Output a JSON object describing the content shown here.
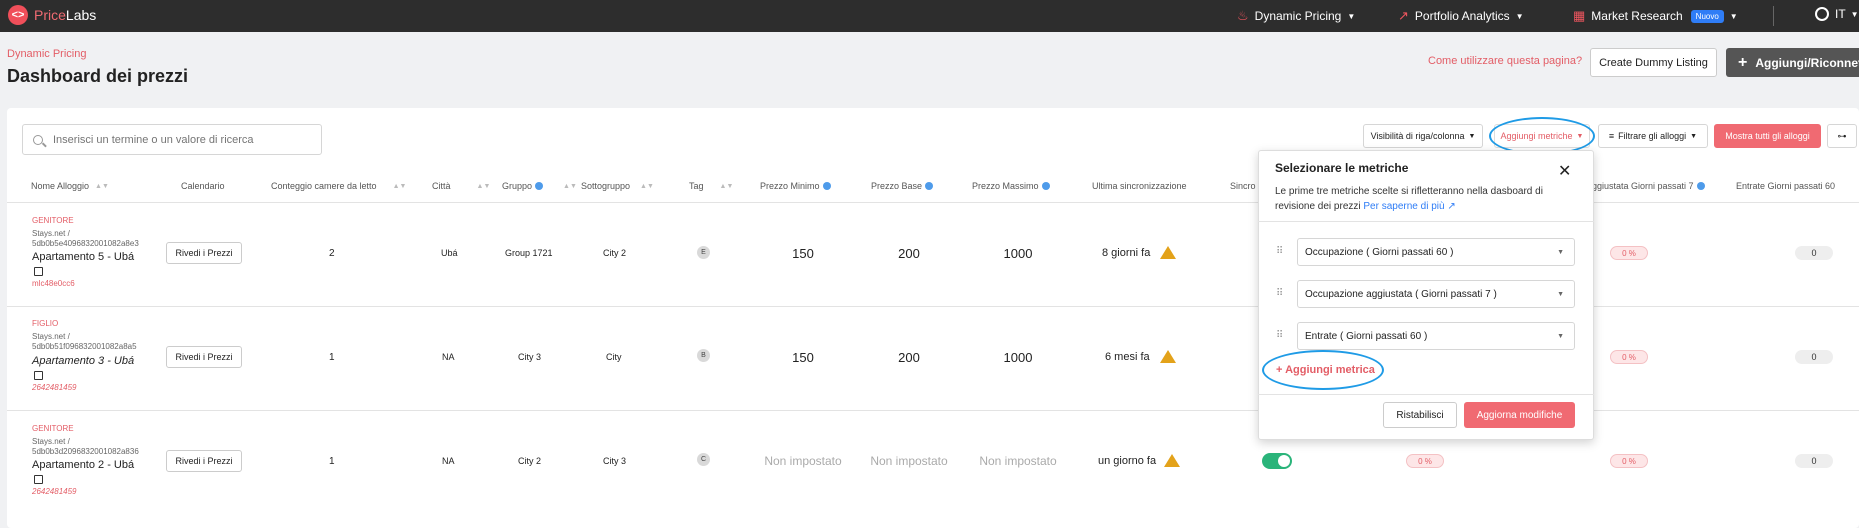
{
  "topbar": {
    "brand_a": "Price",
    "brand_b": "Labs",
    "nav": [
      {
        "label": "Dynamic Pricing"
      },
      {
        "label": "Portfolio Analytics"
      },
      {
        "label": "Market Research",
        "badge": "Nuovo"
      }
    ],
    "lang": "IT"
  },
  "header": {
    "breadcrumb": "Dynamic Pricing",
    "title": "Dashboard dei prezzi",
    "howto": "Come utilizzare questa pagina?",
    "dummy": "Create Dummy Listing",
    "add": "Aggiungi/Riconnetti"
  },
  "toolbar": {
    "search_placeholder": "Inserisci un termine o un valore di ricerca",
    "visibility": "Visibilità di riga/colonna",
    "metrics": "Aggiungi metriche",
    "filter": "Filtrare gli alloggi",
    "show_all": "Mostra tutti gli alloggi"
  },
  "columns": [
    "Nome Alloggio",
    "Calendario",
    "Conteggio camere da letto",
    "Città",
    "Gruppo",
    "Sottogruppo",
    "Tag",
    "Prezzo Minimo",
    "Prezzo Base",
    "Prezzo Massimo",
    "Ultima sincronizzazione",
    "Sincro",
    "ggiustata Giorni passati 7",
    "Entrate Giorni passati 60"
  ],
  "rows": [
    {
      "role": "GENITORE",
      "src1": "Stays.net /",
      "src2": "5db0b5e4096832001082a8e3",
      "name": "Apartamento 5 - Ubá",
      "id": "mlc48e0cc6",
      "review": "Rivedi i Prezzi",
      "bedrooms": "2",
      "city": "Ubá",
      "group": "Group 1721",
      "subgroup": "City 2",
      "tag": "E",
      "min": "150",
      "base": "200",
      "max": "1000",
      "sync": "8 giorni fa",
      "occ7": "0 %",
      "rev60": "0"
    },
    {
      "role": "FIGLIO",
      "src1": "Stays.net /",
      "src2": "5db0b51f0968320010​82a8a5",
      "name": "Apartamento 3 - Ubá",
      "id": "2642481459",
      "review": "Rivedi i Prezzi",
      "bedrooms": "1",
      "city": "NA",
      "group": "City 3",
      "subgroup": "City",
      "tag": "B",
      "min": "150",
      "base": "200",
      "max": "1000",
      "sync": "6 mesi fa",
      "occ7": "0 %",
      "rev60": "0"
    },
    {
      "role": "GENITORE",
      "src1": "Stays.net /",
      "src2": "5db0b3d2096832001082a836",
      "name": "Apartamento 2 - Ubá",
      "id": "2642481459",
      "review": "Rivedi i Prezzi",
      "bedrooms": "1",
      "city": "NA",
      "group": "City 2",
      "subgroup": "City 3",
      "tag": "C",
      "min": "Non impostato",
      "base": "Non impostato",
      "max": "Non impostato",
      "sync": "un giorno fa",
      "occ_a": "0 %",
      "occ7": "0 %",
      "rev60": "0"
    }
  ],
  "panel": {
    "title": "Selezionare le metriche",
    "desc": "Le prime tre metriche scelte si rifletteranno nella dasboard di revisione dei prezzi",
    "learn": "Per saperne di più",
    "metrics": [
      "Occupazione ( Giorni passati 60 )",
      "Occupazione aggiustata ( Giorni passati 7 )",
      "Entrate ( Giorni passati 60 )"
    ],
    "add_metric": "+ Aggiungi metrica",
    "reset": "Ristabilisci",
    "update": "Aggiorna modifiche"
  },
  "colors": {
    "accent": "#f06a72",
    "highlight": "#1f9be6",
    "toggle": "#2ab47a"
  }
}
